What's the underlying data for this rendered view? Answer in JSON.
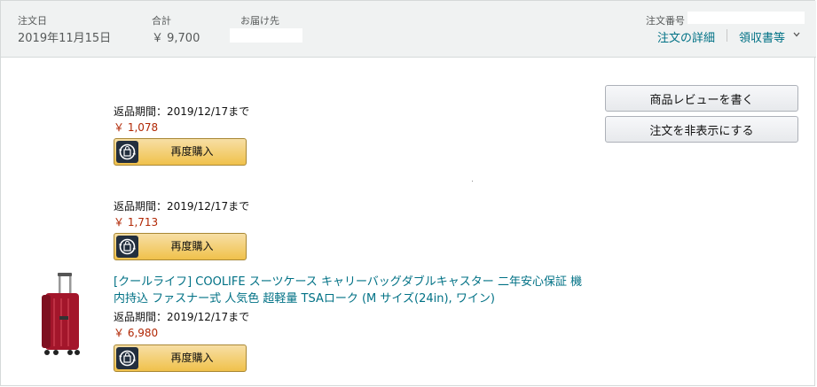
{
  "header": {
    "order_date_label": "注文日",
    "order_date": "2019年11月15日",
    "total_label": "合計",
    "total": "￥ 9,700",
    "ship_to_label": "お届け先",
    "order_number_label": "注文番号",
    "order_details_link": "注文の詳細",
    "receipt_link": "領収書等"
  },
  "actions": {
    "write_review": "商品レビューを書く",
    "hide_order": "注文を非表示にする"
  },
  "items": [
    {
      "return_period": "返品期間：2019/12/17まで",
      "price": "￥ 1,078",
      "buy_again": "再度購入"
    },
    {
      "return_period": "返品期間：2019/12/17まで",
      "price": "￥ 1,713",
      "buy_again": "再度購入"
    },
    {
      "title": "[クールライフ] COOLIFE スーツケース キャリーバッグダブルキャスター 二年安心保証 機内持込 ファスナー式 人気色 超軽量 TSAローク (M サイズ(24in), ワイン)",
      "return_period": "返品期間：2019/12/17まで",
      "price": "￥ 6,980",
      "buy_again": "再度購入"
    }
  ],
  "colors": {
    "link": "#007185",
    "price": "#b12704",
    "button": "#f0c14b",
    "header_bg": "#f0f2f2",
    "product": "#a3162b"
  },
  "icons": [
    "chevron-down-icon",
    "buy-again-icon",
    "suitcase-image"
  ]
}
